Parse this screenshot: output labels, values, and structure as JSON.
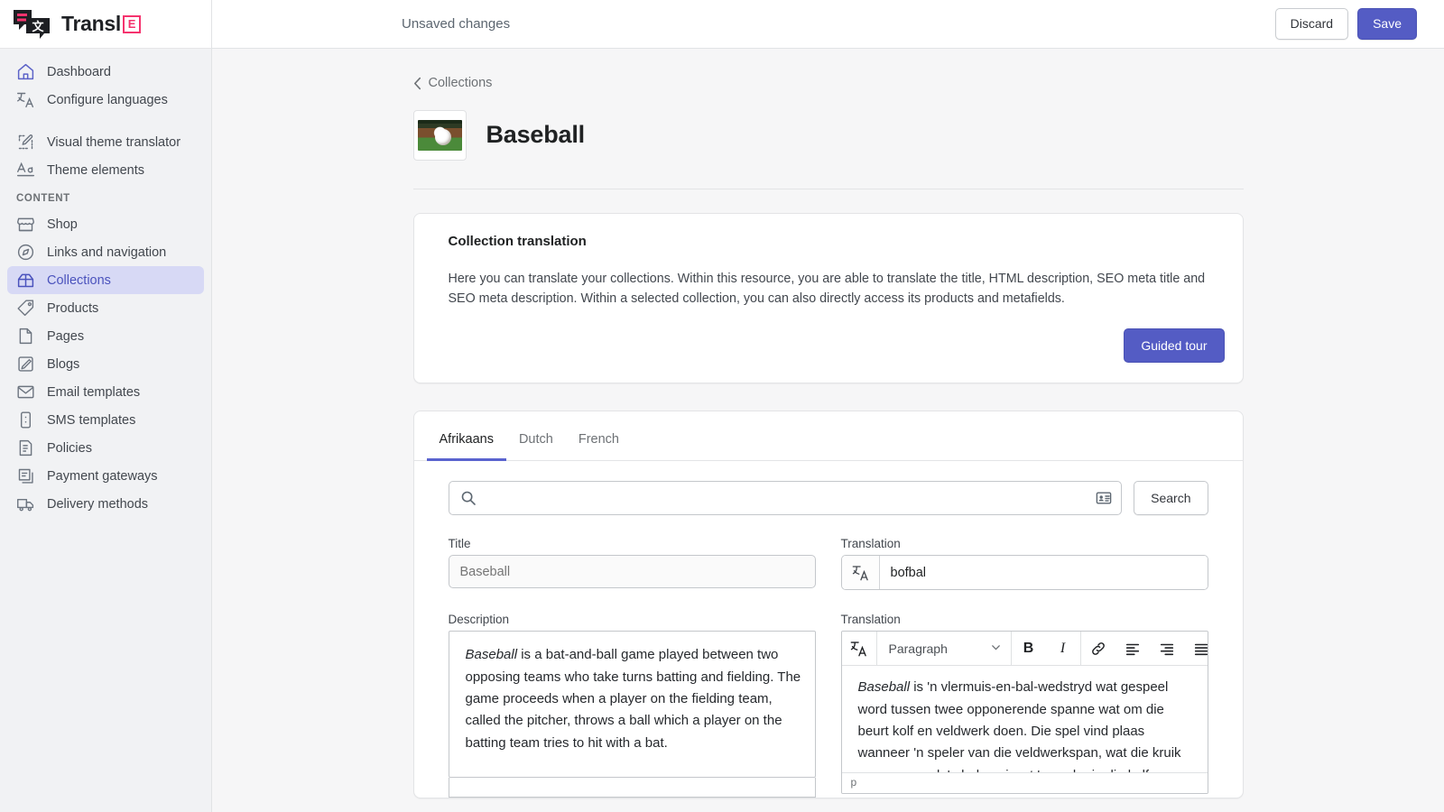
{
  "app": {
    "logo_text": "Transl",
    "logo_badge": "E",
    "logo_icon": "speech-bubbles-translate-icon"
  },
  "sidebar": {
    "items": [
      {
        "label": "Dashboard",
        "icon": "home-icon",
        "active": false
      },
      {
        "label": "Configure languages",
        "icon": "translate-icon",
        "active": false
      }
    ],
    "items2": [
      {
        "label": "Visual theme translator",
        "icon": "theme-edit-icon",
        "active": false
      },
      {
        "label": "Theme elements",
        "icon": "aa-typography-icon",
        "active": false
      }
    ],
    "section_label": "CONTENT",
    "content_items": [
      {
        "label": "Shop",
        "icon": "storefront-icon",
        "active": false
      },
      {
        "label": "Links and navigation",
        "icon": "compass-icon",
        "active": false
      },
      {
        "label": "Collections",
        "icon": "collection-icon",
        "active": true
      },
      {
        "label": "Products",
        "icon": "tag-icon",
        "active": false
      },
      {
        "label": "Pages",
        "icon": "page-icon",
        "active": false
      },
      {
        "label": "Blogs",
        "icon": "pencil-square-icon",
        "active": false
      },
      {
        "label": "Email templates",
        "icon": "envelope-icon",
        "active": false
      },
      {
        "label": "SMS templates",
        "icon": "phone-icon",
        "active": false
      },
      {
        "label": "Policies",
        "icon": "document-list-icon",
        "active": false
      },
      {
        "label": "Payment gateways",
        "icon": "payment-icon",
        "active": false
      },
      {
        "label": "Delivery methods",
        "icon": "truck-icon",
        "active": false
      }
    ]
  },
  "topbar": {
    "status": "Unsaved changes",
    "discard_label": "Discard",
    "save_label": "Save"
  },
  "page": {
    "breadcrumb": "Collections",
    "back_icon": "chevron-left-icon",
    "title": "Baseball",
    "thumbnail_icon": "baseball-thumbnail-image"
  },
  "info_card": {
    "title": "Collection translation",
    "body": "Here you can translate your collections. Within this resource, you are able to translate the title, HTML description, SEO meta title and SEO meta description. Within a selected collection, you can also directly access its products and metafields.",
    "tour_label": "Guided tour"
  },
  "tabs": [
    {
      "label": "Afrikaans",
      "active": true
    },
    {
      "label": "Dutch",
      "active": false
    },
    {
      "label": "French",
      "active": false
    }
  ],
  "search": {
    "placeholder": "",
    "value": "",
    "search_icon": "search-icon",
    "contact_card_icon": "id-card-icon",
    "button_label": "Search"
  },
  "title_field": {
    "label": "Title",
    "placeholder": "Baseball",
    "value": ""
  },
  "title_translation": {
    "label": "Translation",
    "value": "bofbal",
    "translate_icon": "translate-icon"
  },
  "description_field": {
    "label": "Description",
    "emphasis": "Baseball",
    "text": " is a bat-and-ball game played between two opposing teams who take turns batting and fielding. The game proceeds when a player on the fielding team, called the pitcher, throws a ball which a player on the batting team tries to hit with a bat."
  },
  "description_translation": {
    "label": "Translation",
    "emphasis": "Baseball",
    "text": " is 'n vlermuis-en-bal-wedstryd wat gespeel word tussen twee opponerende spanne wat om die beurt kolf en veldwerk doen. Die spel vind plaas wanneer 'n speler van die veldwerkspan, wat die kruik genoem word, 'n bal gooi wat 'n speler in die kolfspan",
    "status": "p",
    "toolbar": {
      "translate_icon": "translate-icon",
      "block_format": "Paragraph",
      "chevron_icon": "chevron-down-icon",
      "bold_label": "B",
      "italic_label": "I",
      "link_icon": "link-icon",
      "align_left_icon": "align-left-icon",
      "align_right_icon": "align-right-icon",
      "align_justify_icon": "align-justify-icon",
      "more_icon": "drag-dots-icon"
    }
  },
  "colors": {
    "accent": "#545cc4",
    "accent_soft": "#d7d9f5",
    "brand_pink": "#f5336e",
    "sidebar_bg": "#f1f2f4",
    "page_bg": "#f6f6f7"
  }
}
